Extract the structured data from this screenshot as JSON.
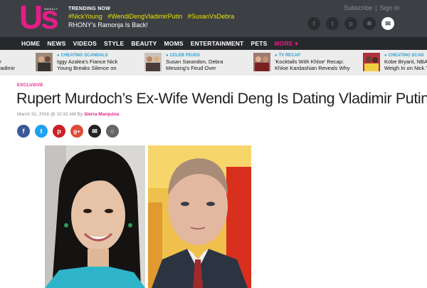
{
  "brand": {
    "logo": "Us",
    "logo_sub": "WEEKLY",
    "accent": "#e61d88"
  },
  "trending": {
    "label": "TRENDING NOW",
    "tags": [
      "#NickYoung",
      "#WendiDengVladimirPutin",
      "#SusanVsDebra"
    ],
    "headline": "RHONY's Ramonja Is Back!"
  },
  "account": {
    "subscribe": "Subscribe",
    "sign_in": "Sign in"
  },
  "socials": {
    "facebook": "f",
    "twitter": "t",
    "pinterest": "p",
    "other": "✱",
    "mail": "✉"
  },
  "nav": {
    "items": [
      "HOME",
      "NEWS",
      "VIDEOS",
      "STYLE",
      "BEAUTY",
      "MOMS",
      "ENTERTAINMENT",
      "PETS"
    ],
    "more": "MORE ▾"
  },
  "ticker": [
    {
      "category": "",
      "title": "ife\nVladimir"
    },
    {
      "category": "CHEATING SCANDALS",
      "title": "Iggy Azalea's Fiance Nick\nYoung Breaks Silence on"
    },
    {
      "category": "CELEB FEUDS",
      "title": "Susan Sarandon, Debra\nMessing's Feud Over"
    },
    {
      "category": "TV RECAP",
      "title": "'Kocktails With Khloe' Recap:\nKhloe Kardashian Reveals Why"
    },
    {
      "category": "CHEATING SCAN",
      "title": "Kobe Bryant, NBA P\nWeigh In on Nick Y"
    }
  ],
  "article": {
    "kicker": "EXCLUSIVE",
    "title": "Rupert Murdoch’s Ex-Wife Wendi Deng Is Dating Vladimir Putin",
    "date": "March 31, 2016 @ 10:32 AM",
    "by": "By",
    "author": "Sierra Marquina"
  },
  "share": {
    "facebook": "f",
    "twitter": "t",
    "pinterest": "p",
    "google": "g+",
    "email": "✉",
    "comment": "○"
  }
}
